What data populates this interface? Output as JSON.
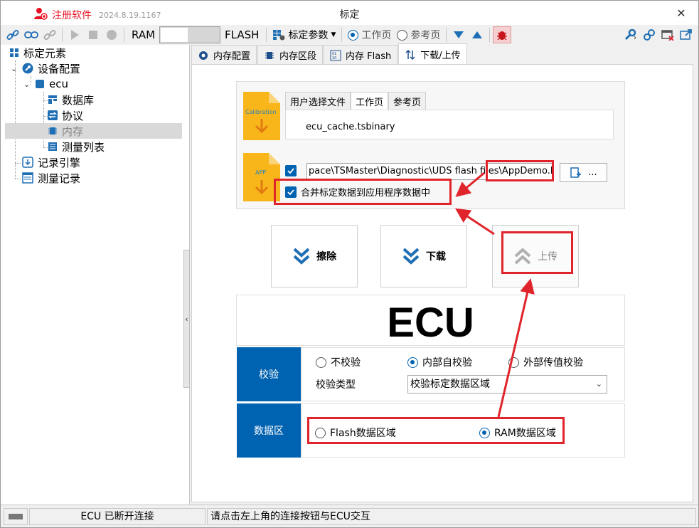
{
  "window": {
    "title": "标定",
    "register_label": "注册软件",
    "version": "2024.8.19.1167"
  },
  "toolbar": {
    "ram_label": "RAM",
    "flash_label": "FLASH",
    "params_label": "标定参数",
    "working_page_label": "工作页",
    "reference_page_label": "参考页",
    "selected_page": "工作页"
  },
  "tree": {
    "root": "标定元素",
    "device_config": "设备配置",
    "ecu": "ecu",
    "database": "数据库",
    "protocol": "协议",
    "memory": "内存",
    "measure_list": "测量列表",
    "record_engine": "记录引擎",
    "measure_record": "测量记录"
  },
  "tabs": [
    "内存配置",
    "内存区段",
    "内存 Flash",
    "下载/上传"
  ],
  "active_tab": "下载/上传",
  "file_section": {
    "calib_icon_text": "Calibration",
    "app_icon_text": "APP",
    "subtabs": [
      "用户选择文件",
      "工作页",
      "参考页"
    ],
    "active_subtab": "工作页",
    "calib_file": "ecu_cache.tsbinary",
    "app_path_prefix": "pace\\TSMaster\\Diagnostic\\UDS flash files\\",
    "app_path_file": "AppDemo.hex",
    "browse_label": "...",
    "merge_label": "合并标定数据到应用程序数据中"
  },
  "actions": {
    "erase": "擦除",
    "download": "下载",
    "upload": "上传"
  },
  "ecu_title": "ECU",
  "verify": {
    "head": "校验",
    "options": [
      "不校验",
      "内部自校验",
      "外部传值校验"
    ],
    "selected": "内部自校验",
    "type_label": "校验类型",
    "type_value": "校验标定数据区域"
  },
  "data_area": {
    "head": "数据区",
    "options": [
      "Flash数据区域",
      "RAM数据区域"
    ],
    "selected": "RAM数据区域"
  },
  "status": {
    "connection": "ECU 已断开连接",
    "hint": "请点击左上角的连接按钮与ECU交互"
  },
  "colors": {
    "accent": "#0063b1",
    "highlight": "#e0242b",
    "file_icon": "#f9b61a"
  }
}
